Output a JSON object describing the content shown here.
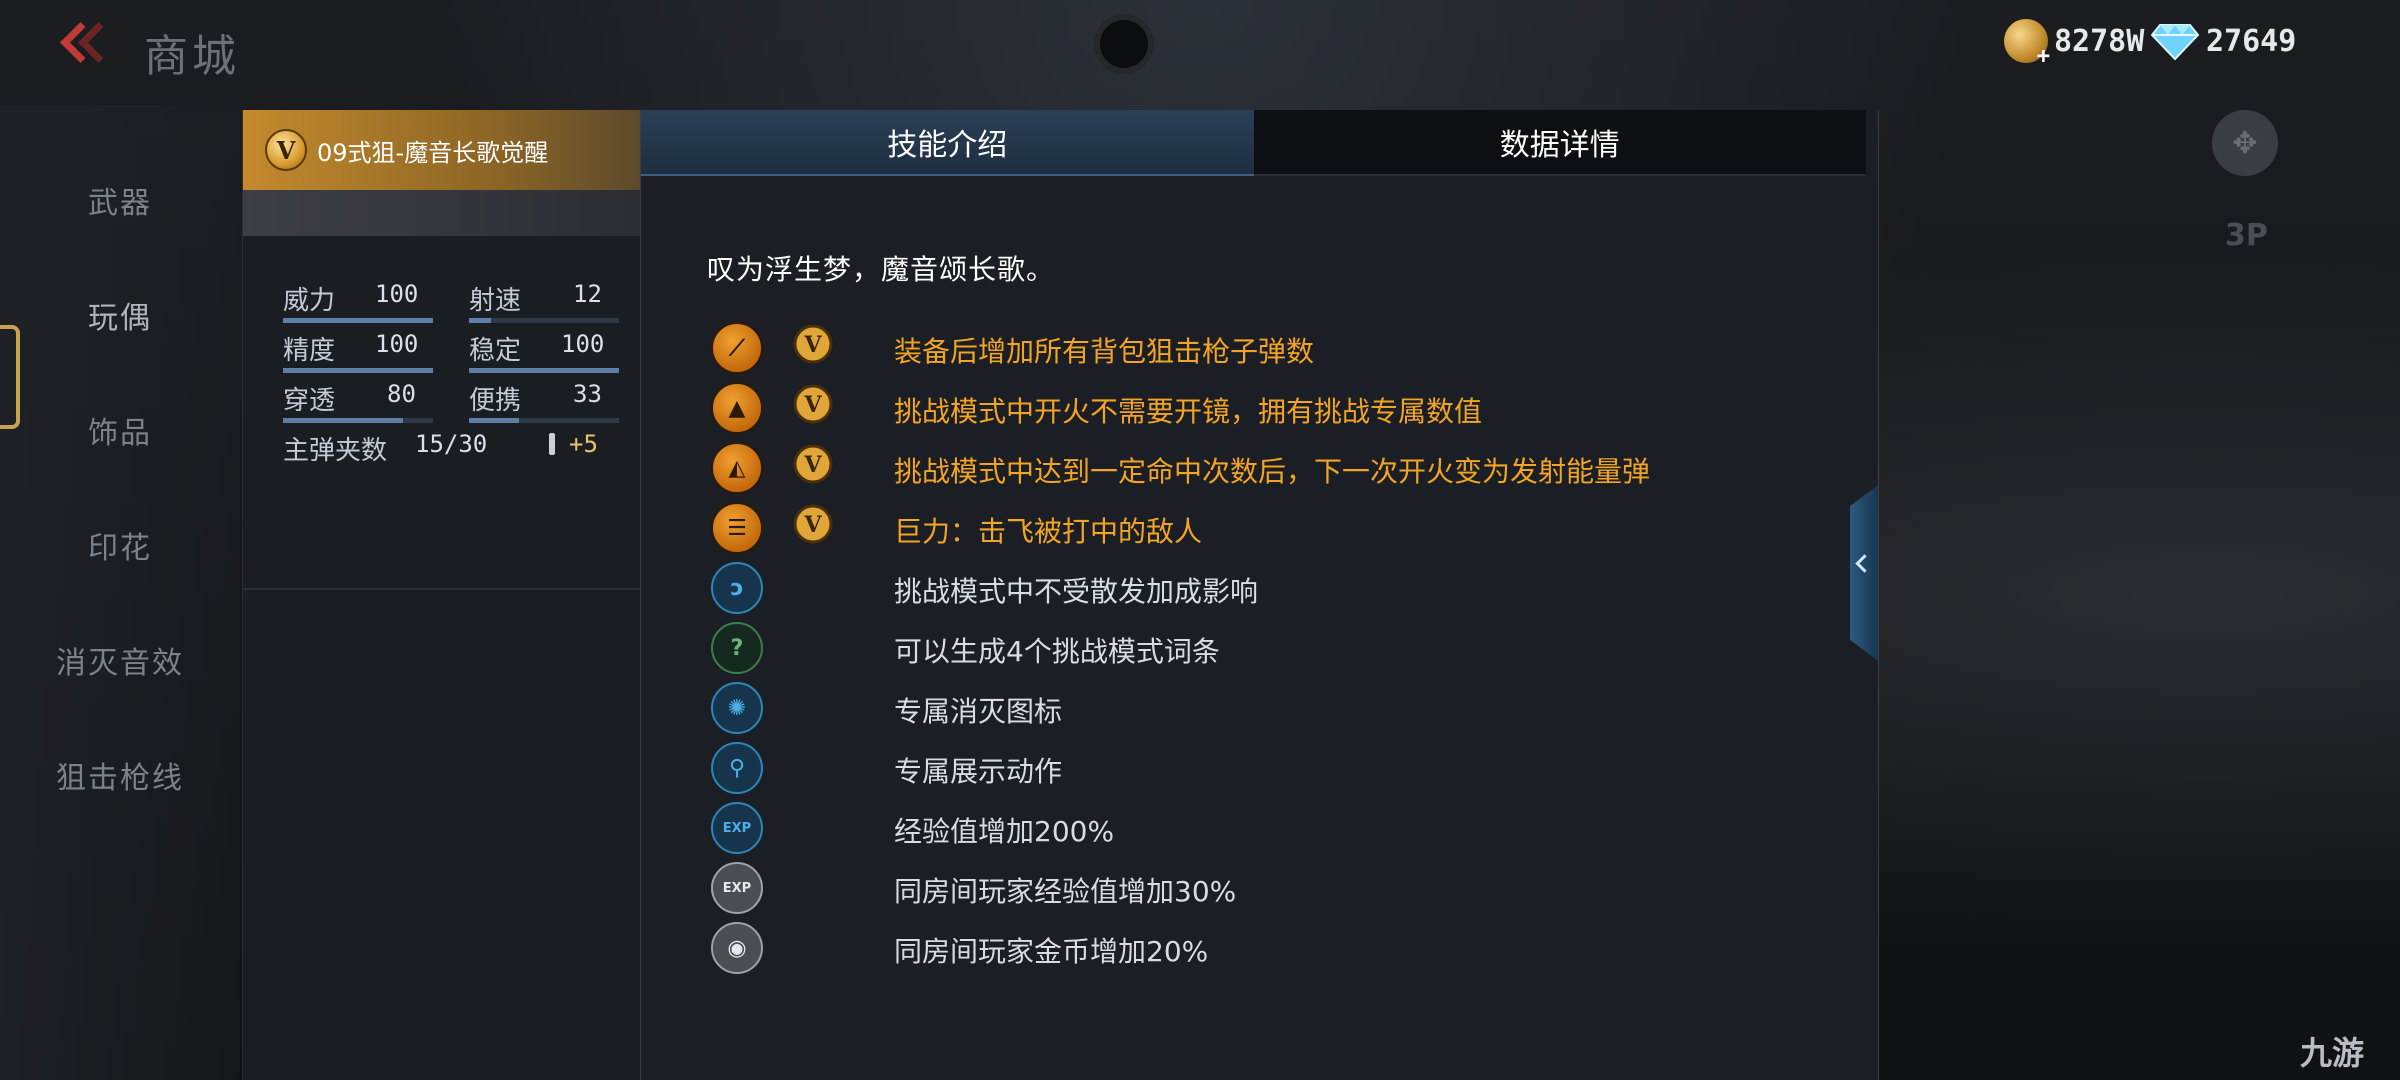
{
  "header": {
    "title": "商城"
  },
  "currency": {
    "gold": "8278W",
    "gems": "27649"
  },
  "nav": {
    "items": [
      {
        "label": "武器"
      },
      {
        "label": "玩偶"
      },
      {
        "label": "饰品"
      },
      {
        "label": "印花"
      },
      {
        "label": "消灭音效"
      },
      {
        "label": "狙击枪线"
      }
    ]
  },
  "weapon": {
    "name": "09式狙-魔音长歌觉醒",
    "stats": [
      {
        "label": "威力",
        "value": "100",
        "fill": 1.0
      },
      {
        "label": "射速",
        "value": "12",
        "fill": 0.12
      },
      {
        "label": "精度",
        "value": "100",
        "fill": 1.0
      },
      {
        "label": "稳定",
        "value": "100",
        "fill": 1.0
      },
      {
        "label": "穿透",
        "value": "80",
        "fill": 0.8
      },
      {
        "label": "便携",
        "value": "33",
        "fill": 0.33
      }
    ],
    "magazine_label": "主弹夹数",
    "magazine_value": "15/30",
    "bonus": "+5"
  },
  "tabs": [
    {
      "label": "技能介绍"
    },
    {
      "label": "数据详情"
    }
  ],
  "intro": "叹为浮生梦，魔音颂长歌。",
  "skills": [
    {
      "text": "装备后增加所有背包狙击枪子弹数",
      "icon": "rifle-icon",
      "color": "gold"
    },
    {
      "text": "挑战模式中开火不需要开镜，拥有挑战专属数值",
      "icon": "challenge-scope-icon",
      "color": "gold"
    },
    {
      "text": "挑战模式中达到一定命中次数后，下一次开火变为发射能量弹",
      "icon": "energy-shot-icon",
      "color": "gold"
    },
    {
      "text": "巨力：击飞被打中的敌人",
      "icon": "knockback-icon",
      "color": "gold"
    },
    {
      "text": "挑战模式中不受散发加成影响",
      "icon": "spread-icon",
      "color": "white"
    },
    {
      "text": "可以生成4个挑战模式词条",
      "icon": "affix-icon",
      "color": "white"
    },
    {
      "text": "专属消灭图标",
      "icon": "kill-icon",
      "color": "white"
    },
    {
      "text": "专属展示动作",
      "icon": "pose-icon",
      "color": "white"
    },
    {
      "text": "经验值增加200%",
      "icon": "exp-icon",
      "color": "white"
    },
    {
      "text": "同房间玩家经验值增加30%",
      "icon": "room-exp-icon",
      "color": "white"
    },
    {
      "text": "同房间玩家金币增加20%",
      "icon": "room-gold-icon",
      "color": "white"
    }
  ],
  "side": {
    "view_mode": "3P"
  },
  "watermark": "九游"
}
